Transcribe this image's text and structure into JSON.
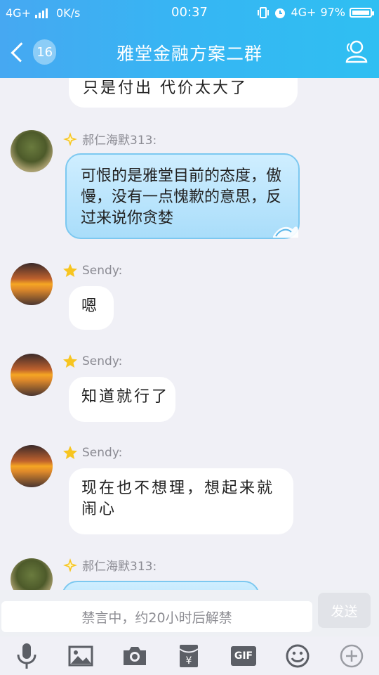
{
  "status_bar": {
    "network_left": "4G+",
    "speed": "0K/s",
    "time": "00:37",
    "network_right": "4G+",
    "battery": "97%"
  },
  "header": {
    "back_count": "16",
    "title": "雅堂金融方案二群",
    "back_icon": "chevron-left-icon",
    "profile_icon": "group-members-icon"
  },
  "messages": [
    {
      "sender": "",
      "text": "只是付出 代价太大了",
      "style": "handwriting"
    },
    {
      "sender": "郝仁海默313:",
      "text": "可恨的是雅堂目前的态度，傲慢，没有一点愧歉的意思，反过来说你贪婪",
      "style": "blue"
    },
    {
      "sender": "Sendy:",
      "text": "嗯",
      "style": "handwriting"
    },
    {
      "sender": "Sendy:",
      "text": "知道就行了",
      "style": "handwriting"
    },
    {
      "sender": "Sendy:",
      "text": "现在也不想理，想起来就闹心",
      "style": "handwriting"
    },
    {
      "sender": "郝仁海默313:",
      "text": "",
      "style": "blue"
    }
  ],
  "input": {
    "placeholder": "禁言中，约20小时后解禁",
    "send_label": "发送"
  },
  "toolbar": {
    "gif_label": "GIF",
    "items": [
      "microphone-icon",
      "image-icon",
      "camera-icon",
      "red-packet-icon",
      "gif-icon",
      "emoji-icon",
      "plus-icon"
    ]
  },
  "colors": {
    "header_gradient_start": "#46a8f2",
    "header_gradient_end": "#2fbff2",
    "chat_background": "#f0f0f6",
    "blue_bubble": "#a9ddfa"
  }
}
